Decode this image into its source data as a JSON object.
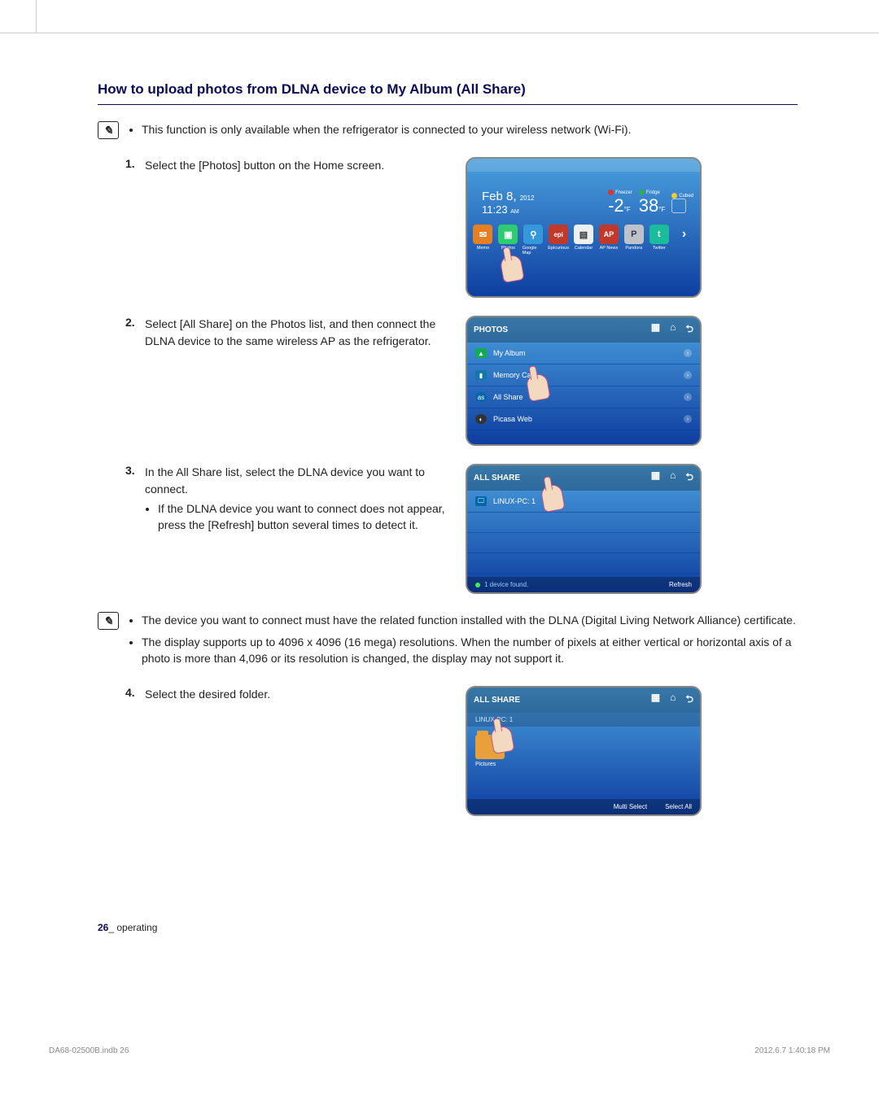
{
  "heading": "How to upload photos from DLNA device to My Album (All Share)",
  "note_top": "This function is only available when the refrigerator is connected to your wireless network (Wi-Fi).",
  "steps": {
    "s1": {
      "num": "1.",
      "text": "Select the [Photos] button on the Home screen."
    },
    "s2": {
      "num": "2.",
      "text": "Select [All Share] on the Photos list, and then connect the DLNA device to the same wireless AP as the refrigerator."
    },
    "s3": {
      "num": "3.",
      "text": "In the All Share list, select the DLNA device you want to connect.",
      "sub": "If the DLNA device you want to connect does not appear, press the [Refresh] button several times to detect it."
    },
    "s4": {
      "num": "4.",
      "text": "Select the desired folder."
    }
  },
  "notes_bottom": {
    "n1": "The device you want to connect must have the related function installed with the DLNA (Digital Living Network Alliance) certificate.",
    "n2": "The display supports up to 4096 x 4096 (16 mega) resolutions. When the number of pixels at either vertical or horizontal axis of a photo is more than 4,096 or its resolution is changed, the display may not support it."
  },
  "homescreen": {
    "date": "Feb 8,",
    "year": "2012",
    "time": "11:23",
    "ampm": "AM",
    "freezer_lbl": "Freezer",
    "freezer_temp": "-2",
    "freezer_unit": "°F",
    "fridge_lbl": "Fridge",
    "fridge_temp": "38",
    "fridge_unit": "°F",
    "cubed": "Cubed",
    "dock": [
      "Memo",
      "Photos",
      "Google Map",
      "Epicurious",
      "Calendar",
      "AP News",
      "Pandora",
      "Twitter"
    ]
  },
  "photos_panel": {
    "title": "PHOTOS",
    "items": [
      "My Album",
      "Memory Card",
      "All Share",
      "Picasa Web"
    ]
  },
  "allshare_panel": {
    "title": "ALL SHARE",
    "device": "LINUX-PC: 1",
    "found": "1 device found.",
    "refresh": "Refresh"
  },
  "folder_panel": {
    "title": "ALL SHARE",
    "crumb": "LINUX-PC: 1",
    "folder": "Pictures",
    "multi": "Multi Select",
    "selall": "Select All"
  },
  "footer": {
    "page": "26",
    "section": "_ operating"
  },
  "print": {
    "left": "DA68-02500B.indb   26",
    "right": "2012.6.7   1:40:18 PM"
  }
}
